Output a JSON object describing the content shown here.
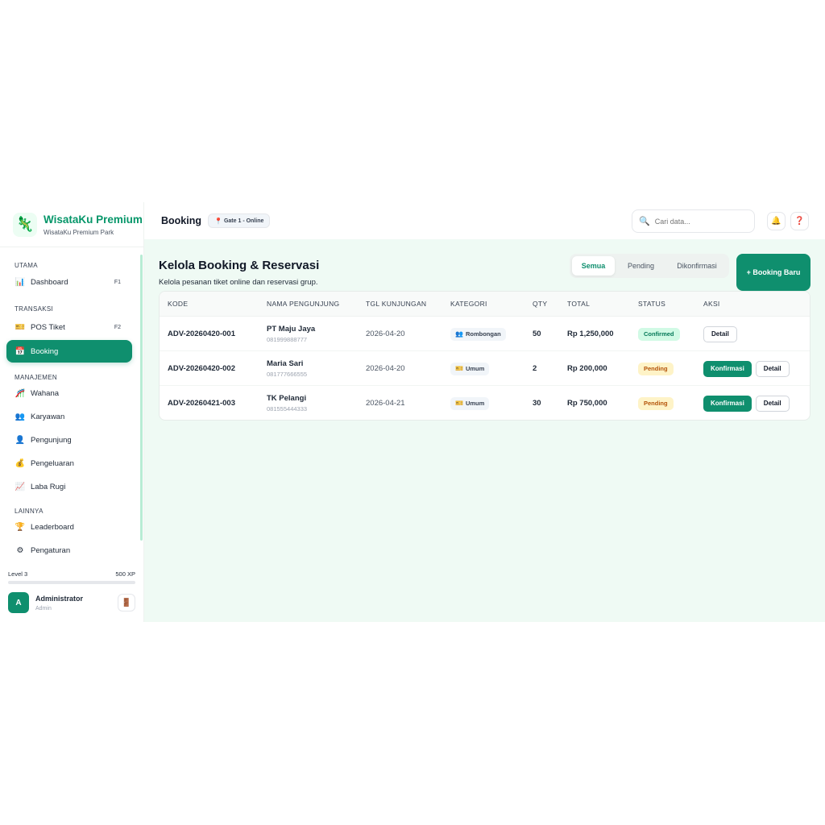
{
  "brand": {
    "title": "WisataKu Premium",
    "subtitle": "WisataKu Premium Park",
    "logo_icon": "🦎"
  },
  "sidebar": {
    "sections": [
      {
        "label": "UTAMA",
        "items": [
          {
            "icon": "📊",
            "label": "Dashboard",
            "key": "F1"
          }
        ]
      },
      {
        "label": "TRANSAKSI",
        "items": [
          {
            "icon": "🎫",
            "label": "POS Tiket",
            "key": "F2"
          },
          {
            "icon": "📅",
            "label": "Booking",
            "key": ""
          }
        ]
      },
      {
        "label": "MANAJEMEN",
        "items": [
          {
            "icon": "🎢",
            "label": "Wahana"
          },
          {
            "icon": "👥",
            "label": "Karyawan"
          },
          {
            "icon": "👤",
            "label": "Pengunjung"
          },
          {
            "icon": "💰",
            "label": "Pengeluaran"
          },
          {
            "icon": "📈",
            "label": "Laba Rugi"
          }
        ]
      },
      {
        "label": "LAINNYA",
        "items": [
          {
            "icon": "🏆",
            "label": "Leaderboard"
          },
          {
            "icon": "⚙",
            "label": "Pengaturan"
          }
        ]
      }
    ],
    "level_label": "Level 3",
    "xp_label": "500 XP",
    "level_progress": 0
  },
  "user": {
    "initial": "A",
    "name": "Administrator",
    "role": "Admin",
    "logout_icon": "🚪"
  },
  "topbar": {
    "title": "Booking",
    "gate_icon": "📍",
    "gate_label": "Gate 1 - Online",
    "search_placeholder": "Cari data...",
    "search_icon": "🔍",
    "bell_icon": "🔔",
    "help_icon": "❓"
  },
  "main": {
    "title": "Kelola Booking & Reservasi",
    "description": "Kelola pesanan tiket online dan reservasi grup.",
    "filters": [
      "Semua",
      "Pending",
      "Dikonfirmasi"
    ],
    "active_filter": 0,
    "new_button": "+ Booking Baru"
  },
  "table": {
    "headers": [
      "KODE",
      "NAMA PENGUNJUNG",
      "TGL KUNJUNGAN",
      "KATEGORI",
      "QTY",
      "TOTAL",
      "STATUS",
      "AKSI"
    ],
    "rows": [
      {
        "code": "ADV-20260420-001",
        "name": "PT Maju Jaya",
        "phone": "081999888777",
        "date": "2026-04-20",
        "category_icon": "👥",
        "category": "Rombongan",
        "qty": "50",
        "total": "Rp 1,250,000",
        "status": "Confirmed",
        "actions": [
          "Detail"
        ]
      },
      {
        "code": "ADV-20260420-002",
        "name": "Maria Sari",
        "phone": "081777666555",
        "date": "2026-04-20",
        "category_icon": "🎫",
        "category": "Umum",
        "qty": "2",
        "total": "Rp 200,000",
        "status": "Pending",
        "actions": [
          "Konfirmasi",
          "Detail"
        ]
      },
      {
        "code": "ADV-20260421-003",
        "name": "TK Pelangi",
        "phone": "081555444333",
        "date": "2026-04-21",
        "category_icon": "🎫",
        "category": "Umum",
        "qty": "30",
        "total": "Rp 750,000",
        "status": "Pending",
        "actions": [
          "Konfirmasi",
          "Detail"
        ]
      }
    ]
  },
  "colors": {
    "accent": "#0f8f6e",
    "brand": "#059669",
    "content_bg": "#effaf4",
    "confirmed": "#047857",
    "pending": "#b45309"
  }
}
